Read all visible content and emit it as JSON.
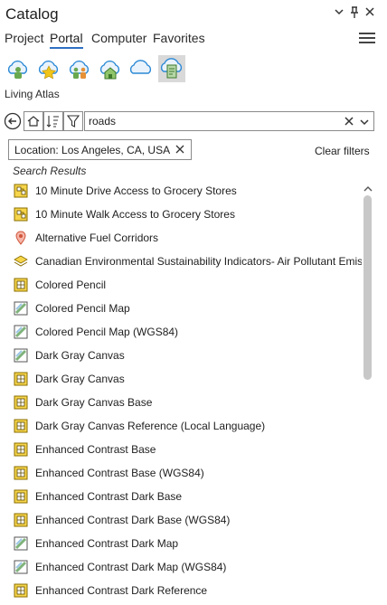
{
  "window": {
    "title": "Catalog"
  },
  "tabs": [
    {
      "label": "Project"
    },
    {
      "label": "Portal",
      "active": true
    },
    {
      "label": "Computer"
    },
    {
      "label": "Favorites"
    }
  ],
  "portal_sections": [
    {
      "icon": "my-content-cloud-icon"
    },
    {
      "icon": "favorites-cloud-icon"
    },
    {
      "icon": "groups-cloud-icon"
    },
    {
      "icon": "organization-cloud-icon"
    },
    {
      "icon": "arcgis-online-cloud-icon"
    },
    {
      "icon": "living-atlas-icon",
      "selected": true
    }
  ],
  "section_label": "Living Atlas",
  "search": {
    "value": "roads"
  },
  "filter_chip": {
    "label": "Location: Los Angeles, CA, USA"
  },
  "clear_filters": "Clear filters",
  "results_header": "Search Results",
  "results": [
    {
      "label": "10 Minute Drive Access to Grocery Stores",
      "icon": "web-map-icon"
    },
    {
      "label": "10 Minute Walk Access to Grocery Stores",
      "icon": "web-map-icon"
    },
    {
      "label": "Alternative Fuel Corridors",
      "icon": "feature-layer-icon"
    },
    {
      "label": "Canadian Environmental Sustainability Indicators- Air Pollutant Emissions",
      "icon": "layer-stack-icon"
    },
    {
      "label": "Colored Pencil",
      "icon": "basemap-icon"
    },
    {
      "label": "Colored Pencil Map",
      "icon": "tile-layer-icon"
    },
    {
      "label": "Colored Pencil Map (WGS84)",
      "icon": "tile-layer-icon"
    },
    {
      "label": "Dark Gray Canvas",
      "icon": "tile-layer-icon"
    },
    {
      "label": "Dark Gray Canvas",
      "icon": "basemap-icon"
    },
    {
      "label": "Dark Gray Canvas Base",
      "icon": "basemap-icon"
    },
    {
      "label": "Dark Gray Canvas Reference (Local Language)",
      "icon": "basemap-icon"
    },
    {
      "label": "Enhanced Contrast Base",
      "icon": "basemap-icon"
    },
    {
      "label": "Enhanced Contrast Base (WGS84)",
      "icon": "basemap-icon"
    },
    {
      "label": "Enhanced Contrast Dark Base",
      "icon": "basemap-icon"
    },
    {
      "label": "Enhanced Contrast Dark Base (WGS84)",
      "icon": "basemap-icon"
    },
    {
      "label": "Enhanced Contrast Dark Map",
      "icon": "tile-layer-icon"
    },
    {
      "label": "Enhanced Contrast Dark Map (WGS84)",
      "icon": "tile-layer-icon"
    },
    {
      "label": "Enhanced Contrast Dark Reference",
      "icon": "basemap-icon"
    }
  ],
  "colors": {
    "accent": "#2f6fc2",
    "cloud_blue": "#2b89d6",
    "icon_yellow": "#f0c419",
    "icon_green": "#6aa84f"
  }
}
